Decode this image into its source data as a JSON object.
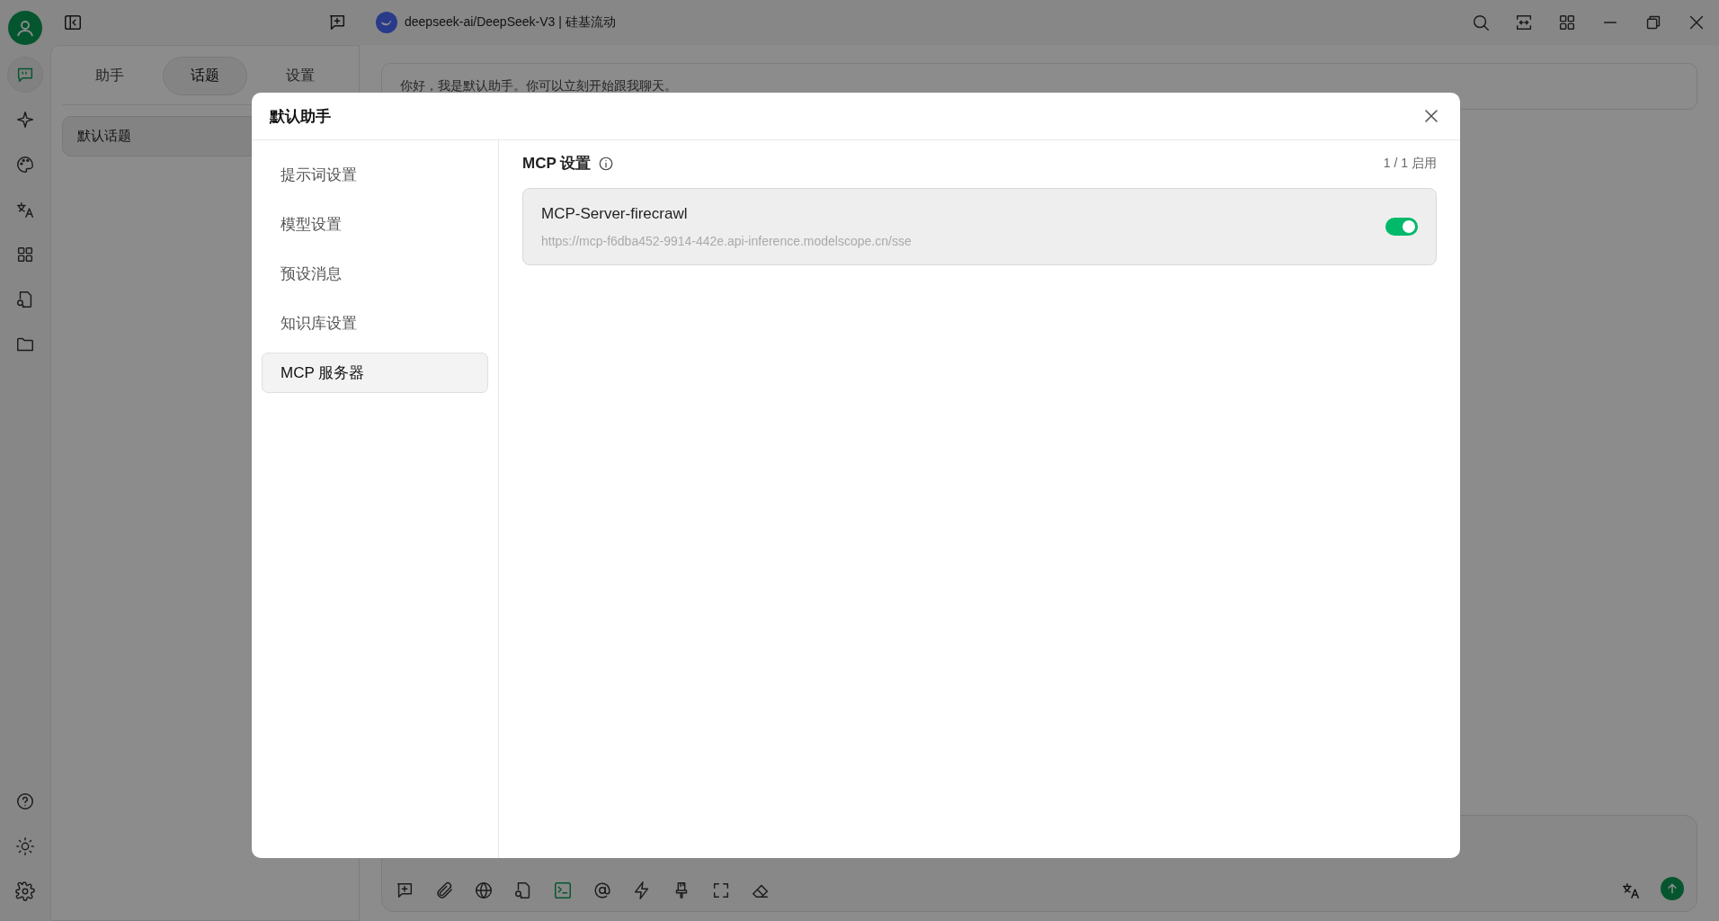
{
  "sidebar": {
    "nav": [
      {
        "kind": "chat",
        "selected": true
      },
      {
        "kind": "sparkle",
        "selected": false
      },
      {
        "kind": "palette",
        "selected": false
      },
      {
        "kind": "translate",
        "selected": false
      },
      {
        "kind": "apps",
        "selected": false
      },
      {
        "kind": "file-search",
        "selected": false
      },
      {
        "kind": "folder",
        "selected": false
      }
    ],
    "bottom": [
      {
        "kind": "help"
      },
      {
        "kind": "theme"
      },
      {
        "kind": "settings"
      }
    ]
  },
  "left_panel": {
    "tabs": [
      {
        "label": "助手",
        "selected": false
      },
      {
        "label": "话题",
        "selected": true
      },
      {
        "label": "设置",
        "selected": false
      }
    ],
    "topics": [
      {
        "label": "默认话题",
        "selected": true
      }
    ]
  },
  "chat": {
    "model": "deepseek-ai/DeepSeek-V3 | 硅基流动",
    "greeting": "你好，我是默认助手。你可以立刻开始跟我聊天。",
    "tools": [
      {
        "kind": "new-topic",
        "on": false
      },
      {
        "kind": "attach",
        "on": false
      },
      {
        "kind": "web",
        "on": false
      },
      {
        "kind": "file-search",
        "on": false
      },
      {
        "kind": "terminal",
        "on": true
      },
      {
        "kind": "mention",
        "on": false
      },
      {
        "kind": "bolt",
        "on": false
      },
      {
        "kind": "brush",
        "on": false
      },
      {
        "kind": "expand",
        "on": false
      },
      {
        "kind": "eraser",
        "on": false
      }
    ]
  },
  "dialog": {
    "title": "默认助手",
    "menu": [
      {
        "label": "提示词设置",
        "selected": false
      },
      {
        "label": "模型设置",
        "selected": false
      },
      {
        "label": "预设消息",
        "selected": false
      },
      {
        "label": "知识库设置",
        "selected": false
      },
      {
        "label": "MCP 服务器",
        "selected": true
      }
    ],
    "section_title": "MCP 设置",
    "enabled_count": "1 / 1 启用",
    "servers": [
      {
        "name": "MCP-Server-firecrawl",
        "url": "https://mcp-f6dba452-9914-442e.api-inference.modelscope.cn/sse",
        "on": true
      }
    ]
  }
}
